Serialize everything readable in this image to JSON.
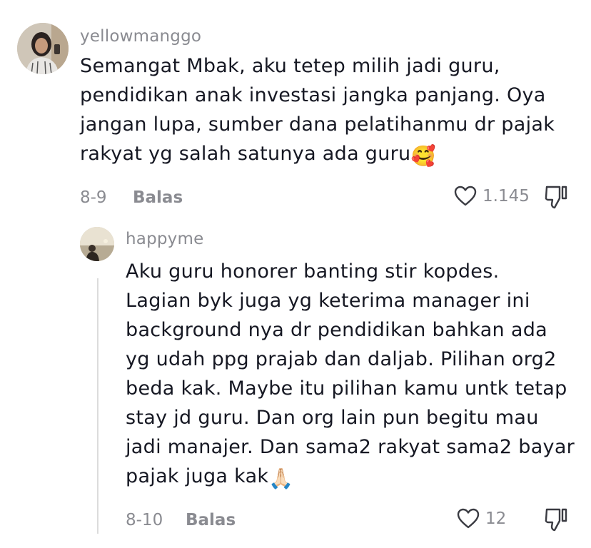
{
  "comments": [
    {
      "username": "yellowmanggo",
      "text": "Semangat Mbak, aku tetep milih jadi guru,\npendidikan anak investasi jangka panjang. Oya\njangan lupa, sumber dana pelatihanmu dr pajak\nrakyat yg salah satunya ada guru",
      "emoji": "🥰",
      "date": "8-9",
      "reply_label": "Balas",
      "likes": "1.145",
      "avatar_icon": "profile-photo"
    },
    {
      "username": "happyme",
      "text": "Aku guru honorer banting stir kopdes.\nLagian byk juga yg keterima manager ini\nbackground nya dr pendidikan bahkan ada\nyg udah ppg prajab dan daljab. Pilihan org2\nbeda kak. Maybe itu pilihan kamu untk tetap\nstay jd guru. Dan org lain pun begitu mau\njadi manajer. Dan sama2 rakyat sama2 bayar\npajak juga kak",
      "emoji": "🙏🏻",
      "date": "8-10",
      "reply_label": "Balas",
      "likes": "12",
      "avatar_icon": "profile-photo"
    }
  ],
  "icons": {
    "like": "heart-outline-icon",
    "dislike": "thumbs-down-icon"
  },
  "colors": {
    "text": "#161823",
    "muted": "#8a8b91"
  }
}
